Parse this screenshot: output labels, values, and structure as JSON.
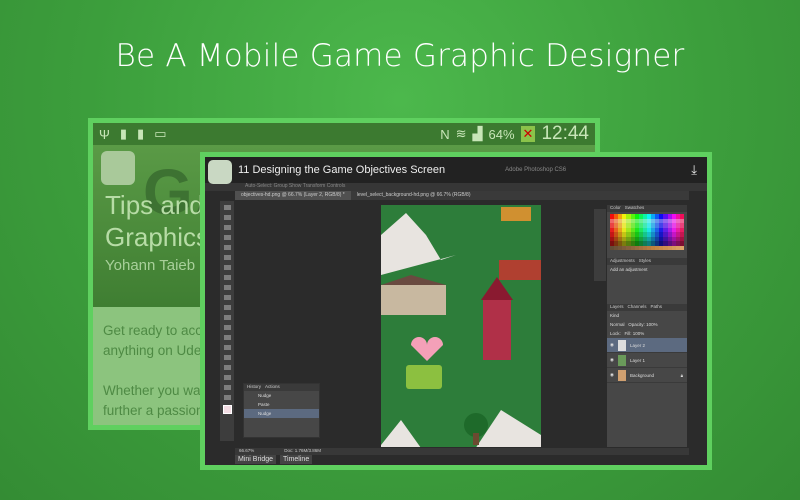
{
  "headline": "Be A Mobile Game Graphic Designer",
  "phone": {
    "status": {
      "battery": "64%",
      "time": "12:44"
    },
    "course_title_partial": "Tips and\nGraphics",
    "big_letters": "GA",
    "author": "Yohann Taieb",
    "description": [
      "Get ready to acce",
      "anything on Uden",
      "",
      "Whether you wan",
      "further a passion,"
    ]
  },
  "player": {
    "lesson_title": "11  Designing the Game Objectives Screen",
    "app_name": "Adobe Photoshop CS6",
    "download_icon": "download-icon",
    "options_bar": "Auto-Select:  Group   Show Transform Controls",
    "doc_tabs": [
      "objectives-hd.png @ 66.7% (Layer 2, RGB/8) *",
      "level_select_background-hd.png @ 66.7% (RGB/8)"
    ],
    "panels": {
      "color_tabs": [
        "Color",
        "Swatches"
      ],
      "adjust_tabs": [
        "Adjustments",
        "Styles"
      ],
      "adjust_hint": "Add an adjustment",
      "layer_tabs": [
        "Layers",
        "Channels",
        "Paths"
      ],
      "blend_mode": "Normal",
      "opacity_label": "Opacity:",
      "opacity": "100%",
      "lock_label": "Lock:",
      "fill_label": "Fill:",
      "fill": "100%",
      "kind": "Kind",
      "layers": [
        "Layer 2",
        "Layer 1",
        "Background"
      ]
    },
    "history": {
      "tabs": [
        "History",
        "Actions"
      ],
      "items": [
        "Nudge",
        "Paste",
        "Nudge"
      ]
    },
    "status": {
      "zoom": "66.67%",
      "doc": "Doc: 1.76M/3.86M"
    },
    "bottom_tabs": [
      "Mini Bridge",
      "Timeline"
    ]
  }
}
